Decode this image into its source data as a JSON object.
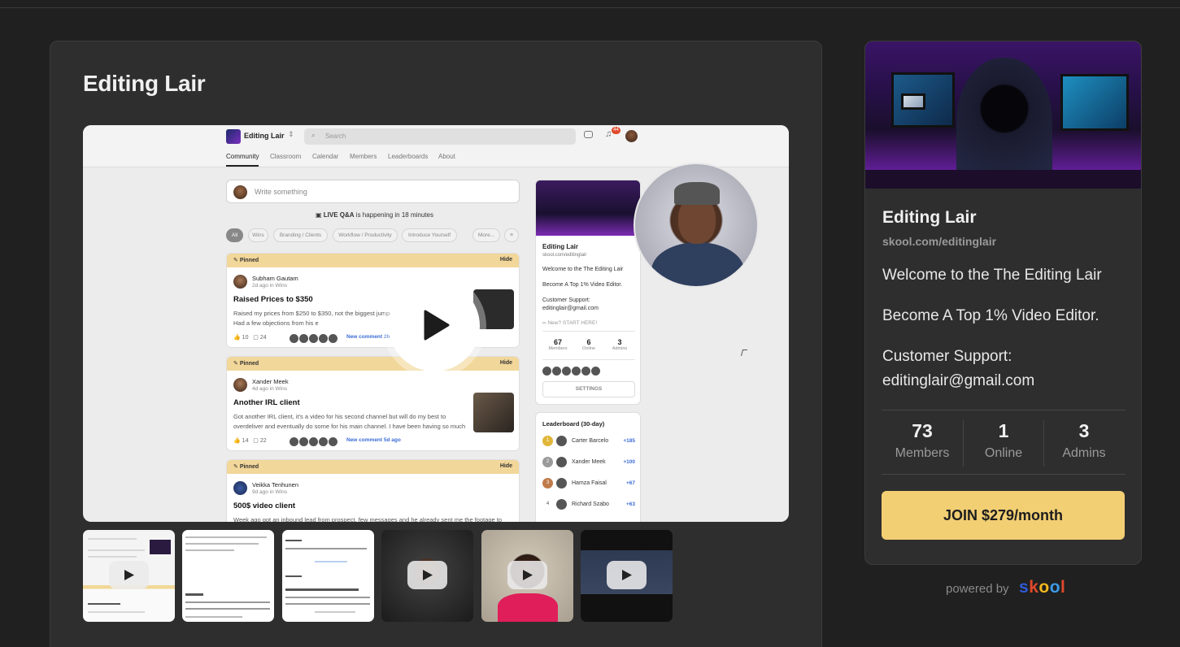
{
  "group": {
    "title": "Editing Lair"
  },
  "preview": {
    "brand": "Editing Lair",
    "search_placeholder": "Search",
    "notification_count": "44",
    "nav": [
      "Community",
      "Classroom",
      "Calendar",
      "Members",
      "Leaderboards",
      "About"
    ],
    "write_placeholder": "Write something",
    "live_prefix": "LIVE Q&A",
    "live_suffix": "is happening in 18 minutes",
    "chips": [
      "All",
      "Wins",
      "Branding / Clients",
      "Workflow / Productivity",
      "Introduce Yourself",
      "More..."
    ],
    "posts": [
      {
        "pinned": "Pinned",
        "hide": "Hide",
        "author": "Subham Gautam",
        "meta": "2d ago in Wins",
        "title": "Raised Prices to $350",
        "body": "Raised my prices from $250 to $350, not the biggest jump love working with this guy. Had a few objections from his e",
        "likes": "10",
        "comments": "24",
        "new_comment": "New comment 2h ago"
      },
      {
        "pinned": "Pinned",
        "hide": "Hide",
        "author": "Xander Meek",
        "meta": "4d ago in Wins",
        "title": "Another IRL client",
        "body": "Got another IRL client, it's a video for his second channel but will do my best to overdeliver and eventually do some for his main channel. I have been having so much",
        "likes": "14",
        "comments": "22",
        "new_comment": "New comment 5d ago"
      },
      {
        "pinned": "Pinned",
        "hide": "Hide",
        "author": "Veikka Tenhunen",
        "meta": "9d ago in Wins",
        "title": "500$ video client",
        "body": "Week ago got an inbound lead from prospect, few messages and he already sent me the footage to"
      }
    ],
    "side": {
      "title": "Editing Lair",
      "url": "skool.com/editinglair",
      "welcome": "Welcome to the The Editing Lair",
      "tagline": "Become A Top 1% Video Editor.",
      "support_label": "Customer Support:",
      "support_email": "editinglair@gmail.com",
      "new_start": "New? START HERE!",
      "stats": [
        {
          "value": "67",
          "label": "Members"
        },
        {
          "value": "6",
          "label": "Online"
        },
        {
          "value": "3",
          "label": "Admins"
        }
      ],
      "settings": "SETTINGS"
    },
    "leaderboard": {
      "title": "Leaderboard (30-day)",
      "rows": [
        {
          "rank": "1",
          "name": "Carter Barcelo",
          "points": "+185"
        },
        {
          "rank": "2",
          "name": "Xander Meek",
          "points": "+100"
        },
        {
          "rank": "3",
          "name": "Hamza Faisal",
          "points": "+67"
        },
        {
          "rank": "4",
          "name": "Richard Szabo",
          "points": "+63"
        }
      ]
    }
  },
  "sidebar": {
    "title": "Editing Lair",
    "url": "skool.com/editinglair",
    "welcome": "Welcome to the The Editing Lair",
    "tagline": "Become A Top 1% Video Editor.",
    "support_label": "Customer Support:",
    "support_email": "editinglair@gmail.com",
    "stats": [
      {
        "value": "73",
        "label": "Members"
      },
      {
        "value": "1",
        "label": "Online"
      },
      {
        "value": "3",
        "label": "Admins"
      }
    ],
    "join_label": "JOIN $279/month"
  },
  "footer": {
    "powered_by": "powered by",
    "brand_letters": [
      "s",
      "k",
      "o",
      "o",
      "l"
    ],
    "brand_colors": [
      "#2e5bd8",
      "#e0492b",
      "#f3b71e",
      "#3d9be8",
      "#e0492b"
    ]
  },
  "colors": {
    "background": "#202020",
    "card": "#2e2e2e",
    "join_button": "#f3cf74",
    "pinned_banner": "#f2d79a",
    "link_blue": "#3b6bd6"
  }
}
